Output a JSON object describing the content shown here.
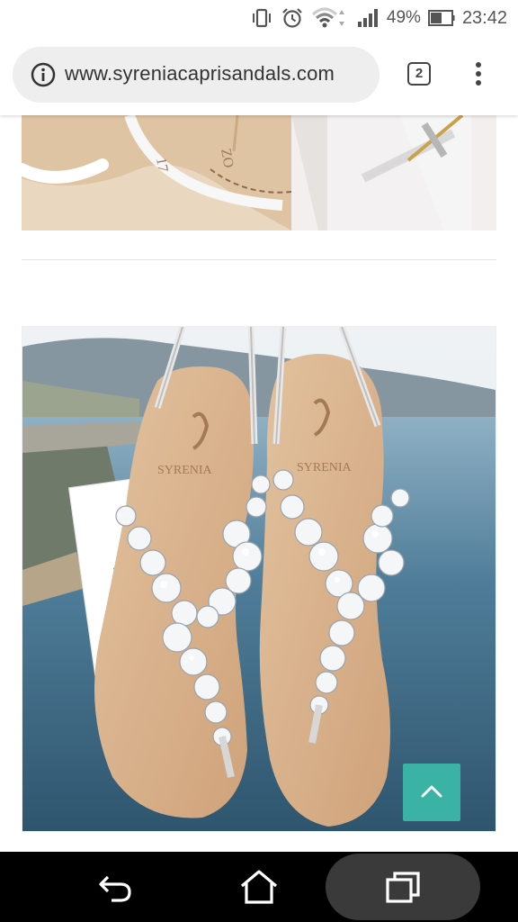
{
  "status_bar": {
    "battery_percent": "49%",
    "time": "23:42"
  },
  "browser": {
    "url": "www.syreniacaprisandals.com",
    "tab_count": "2"
  },
  "product_images": [
    {
      "label": "sandal-detail-photo"
    },
    {
      "label": "crystal-sandals-photo",
      "brand_mark": "SYRENIA",
      "tag_text": "SYRENIA"
    }
  ],
  "colors": {
    "accent": "#3bb3a4",
    "leather": "#d9b68f",
    "sea": "#3d6a86"
  },
  "icons": [
    "vibrate-icon",
    "alarm-icon",
    "wifi-icon",
    "signal-icon",
    "battery-icon",
    "info-icon",
    "back-icon",
    "home-icon",
    "recent-apps-icon",
    "chevron-up-icon"
  ]
}
